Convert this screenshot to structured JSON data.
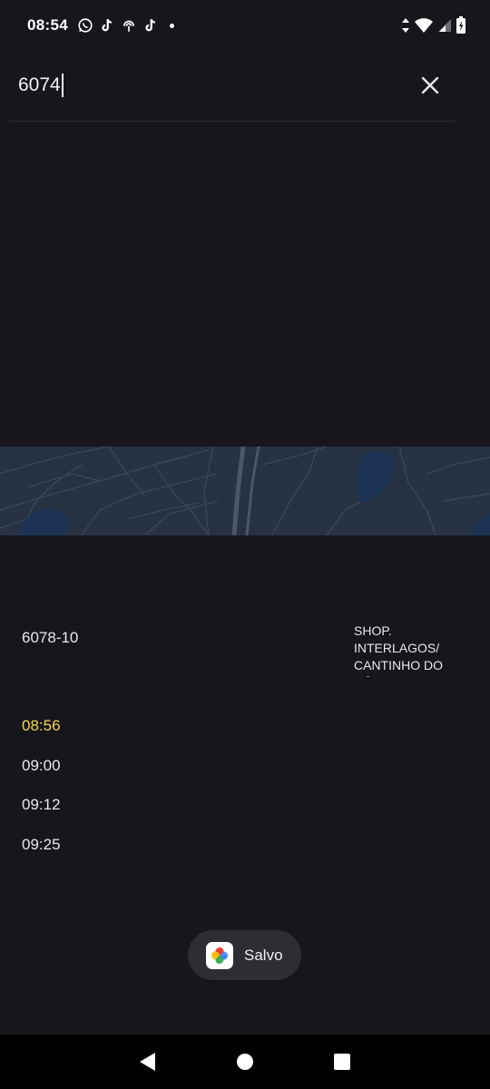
{
  "status_bar": {
    "time": "08:54",
    "icons": [
      "whatsapp-icon",
      "tiktok-icon",
      "hotspot-icon",
      "tiktok-icon",
      "notification-dot"
    ],
    "right_icons": [
      "data-arrows-icon",
      "wifi-icon",
      "signal-icon",
      "battery-icon"
    ]
  },
  "search": {
    "value": "6074"
  },
  "route": {
    "code": "6078-10",
    "destination": "SHOP. INTERLAGOS/ CANTINHO DO CÉU"
  },
  "times": [
    "08:56",
    "09:00",
    "09:12",
    "09:25"
  ],
  "toast": {
    "label": "Salvo",
    "icon": "google-photos-icon"
  },
  "colors": {
    "background": "#17161c",
    "next_time": "#f3d54e",
    "map": "#273242"
  }
}
